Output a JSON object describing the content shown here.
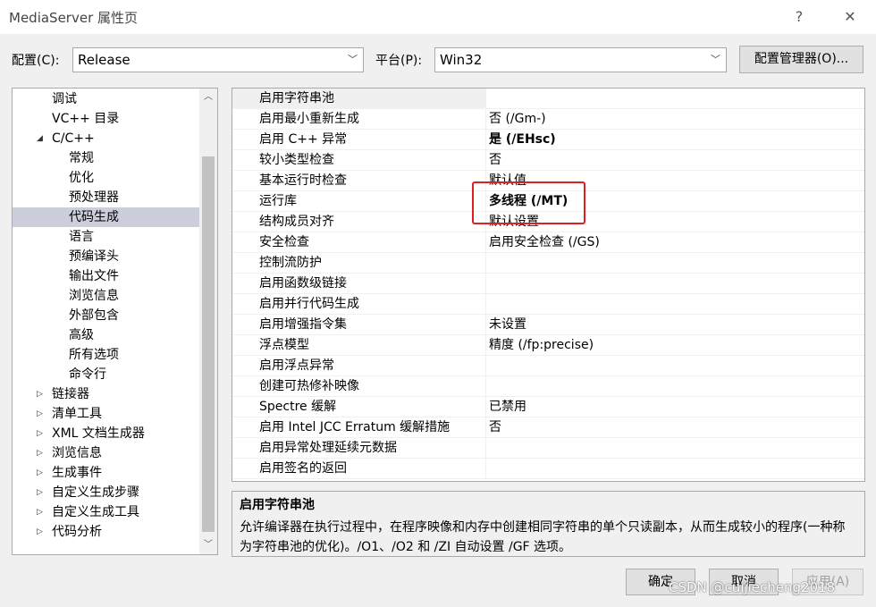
{
  "window": {
    "title": "MediaServer 属性页",
    "help_glyph": "?",
    "close_glyph": "✕"
  },
  "toolbar": {
    "config_label": "配置(C):",
    "config_value": "Release",
    "platform_label": "平台(P):",
    "platform_value": "Win32",
    "config_manager_label": "配置管理器(O)..."
  },
  "tree": {
    "items": [
      {
        "label": "调试",
        "level": 1,
        "expander": ""
      },
      {
        "label": "VC++ 目录",
        "level": 1,
        "expander": ""
      },
      {
        "label": "C/C++",
        "level": 1,
        "expander": "◢"
      },
      {
        "label": "常规",
        "level": 2,
        "expander": ""
      },
      {
        "label": "优化",
        "level": 2,
        "expander": ""
      },
      {
        "label": "预处理器",
        "level": 2,
        "expander": ""
      },
      {
        "label": "代码生成",
        "level": 2,
        "expander": "",
        "selected": true
      },
      {
        "label": "语言",
        "level": 2,
        "expander": ""
      },
      {
        "label": "预编译头",
        "level": 2,
        "expander": ""
      },
      {
        "label": "输出文件",
        "level": 2,
        "expander": ""
      },
      {
        "label": "浏览信息",
        "level": 2,
        "expander": ""
      },
      {
        "label": "外部包含",
        "level": 2,
        "expander": ""
      },
      {
        "label": "高级",
        "level": 2,
        "expander": ""
      },
      {
        "label": "所有选项",
        "level": 2,
        "expander": ""
      },
      {
        "label": "命令行",
        "level": 2,
        "expander": ""
      },
      {
        "label": "链接器",
        "level": 1,
        "expander": "▷"
      },
      {
        "label": "清单工具",
        "level": 1,
        "expander": "▷"
      },
      {
        "label": "XML 文档生成器",
        "level": 1,
        "expander": "▷"
      },
      {
        "label": "浏览信息",
        "level": 1,
        "expander": "▷"
      },
      {
        "label": "生成事件",
        "level": 1,
        "expander": "▷"
      },
      {
        "label": "自定义生成步骤",
        "level": 1,
        "expander": "▷"
      },
      {
        "label": "自定义生成工具",
        "level": 1,
        "expander": "▷"
      },
      {
        "label": "代码分析",
        "level": 1,
        "expander": "▷"
      }
    ]
  },
  "properties": [
    {
      "name": "启用字符串池",
      "value": "",
      "bold": false,
      "selected": true
    },
    {
      "name": "启用最小重新生成",
      "value": "否 (/Gm-)",
      "bold": false
    },
    {
      "name": "启用 C++ 异常",
      "value": "是 (/EHsc)",
      "bold": true
    },
    {
      "name": "较小类型检查",
      "value": "否",
      "bold": false
    },
    {
      "name": "基本运行时检查",
      "value": "默认值",
      "bold": false
    },
    {
      "name": "运行库",
      "value": "多线程 (/MT)",
      "bold": true
    },
    {
      "name": "结构成员对齐",
      "value": "默认设置",
      "bold": false
    },
    {
      "name": "安全检查",
      "value": "启用安全检查 (/GS)",
      "bold": false
    },
    {
      "name": "控制流防护",
      "value": "",
      "bold": false
    },
    {
      "name": "启用函数级链接",
      "value": "",
      "bold": false
    },
    {
      "name": "启用并行代码生成",
      "value": "",
      "bold": false
    },
    {
      "name": "启用增强指令集",
      "value": "未设置",
      "bold": false
    },
    {
      "name": "浮点模型",
      "value": "精度 (/fp:precise)",
      "bold": false
    },
    {
      "name": "启用浮点异常",
      "value": "",
      "bold": false
    },
    {
      "name": "创建可热修补映像",
      "value": "",
      "bold": false
    },
    {
      "name": "Spectre 缓解",
      "value": "已禁用",
      "bold": false
    },
    {
      "name": "启用 Intel JCC Erratum 缓解措施",
      "value": "否",
      "bold": false
    },
    {
      "name": "启用异常处理延续元数据",
      "value": "",
      "bold": false
    },
    {
      "name": "启用签名的返回",
      "value": "",
      "bold": false
    }
  ],
  "description": {
    "title": "启用字符串池",
    "text": "允许编译器在执行过程中，在程序映像和内存中创建相同字符串的单个只读副本，从而生成较小的程序(一种称为字符串池的优化)。/O1、/O2 和 /ZI 自动设置 /GF 选项。"
  },
  "footer": {
    "ok_label": "确定",
    "cancel_label": "取消",
    "apply_label": "应用(A)"
  },
  "watermark": "CSDN @cuijiecheng2018",
  "colors": {
    "highlight": "#e02020",
    "selection": "#cccedb"
  }
}
